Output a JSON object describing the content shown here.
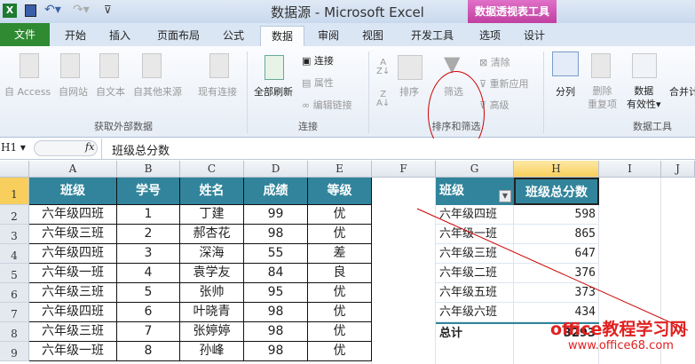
{
  "window": {
    "title": "数据源 - Microsoft Excel",
    "context_tool": "数据透视表工具"
  },
  "tabs": [
    "文件",
    "开始",
    "插入",
    "页面布局",
    "公式",
    "数据",
    "审阅",
    "视图",
    "开发工具",
    "选项",
    "设计"
  ],
  "active_tab": "数据",
  "ribbon": {
    "external": {
      "items": [
        "自 Access",
        "自网站",
        "自文本",
        "自其他来源",
        "现有连接"
      ],
      "group": "获取外部数据"
    },
    "connections": {
      "refresh": "全部刷新",
      "items": [
        "连接",
        "属性",
        "编辑链接"
      ],
      "group": "连接"
    },
    "sort_filter": {
      "sort": "排序",
      "filter": "筛选",
      "clear": "清除",
      "reapply": "重新应用",
      "advanced": "高级",
      "group": "排序和筛选"
    },
    "data_tools": {
      "split": "分列",
      "remove_dup_1": "删除",
      "remove_dup_2": "重复项",
      "validation_1": "数据",
      "validation_2": "有效性",
      "merge": "合并计",
      "group": "数据工具"
    }
  },
  "formula_bar": {
    "name_box": "H1",
    "fx": "fx",
    "value": "班级总分数"
  },
  "columns": [
    "A",
    "B",
    "C",
    "D",
    "E",
    "F",
    "G",
    "H",
    "I",
    "J"
  ],
  "rows": [
    "1",
    "2",
    "3",
    "4",
    "5",
    "6",
    "7",
    "8",
    "9"
  ],
  "table": {
    "headers": [
      "班级",
      "学号",
      "姓名",
      "成绩",
      "等级"
    ],
    "rows": [
      [
        "六年级四班",
        "1",
        "丁建",
        "99",
        "优"
      ],
      [
        "六年级三班",
        "2",
        "郝杏花",
        "98",
        "优"
      ],
      [
        "六年级四班",
        "3",
        "深海",
        "55",
        "差"
      ],
      [
        "六年级一班",
        "4",
        "袁学友",
        "84",
        "良"
      ],
      [
        "六年级三班",
        "5",
        "张帅",
        "95",
        "优"
      ],
      [
        "六年级四班",
        "6",
        "叶晓青",
        "98",
        "优"
      ],
      [
        "六年级三班",
        "7",
        "张婷婷",
        "98",
        "优"
      ],
      [
        "六年级一班",
        "8",
        "孙峰",
        "98",
        "优"
      ]
    ]
  },
  "pivot": {
    "headers": [
      "班级",
      "班级总分数"
    ],
    "rows": [
      [
        "六年级四班",
        "598"
      ],
      [
        "六年级一班",
        "865"
      ],
      [
        "六年级三班",
        "647"
      ],
      [
        "六年级二班",
        "376"
      ],
      [
        "六年级五班",
        "373"
      ],
      [
        "六年级六班",
        "434"
      ]
    ],
    "total_label": "总计",
    "total_value": "3293"
  },
  "watermark": {
    "line1": "office教程学习网",
    "line2": "www.office68.com"
  },
  "colors": {
    "header_fill": "#31849b",
    "file_tab": "#2f8a32",
    "context_tab": "#c040a0",
    "annotation": "#cc0000"
  }
}
